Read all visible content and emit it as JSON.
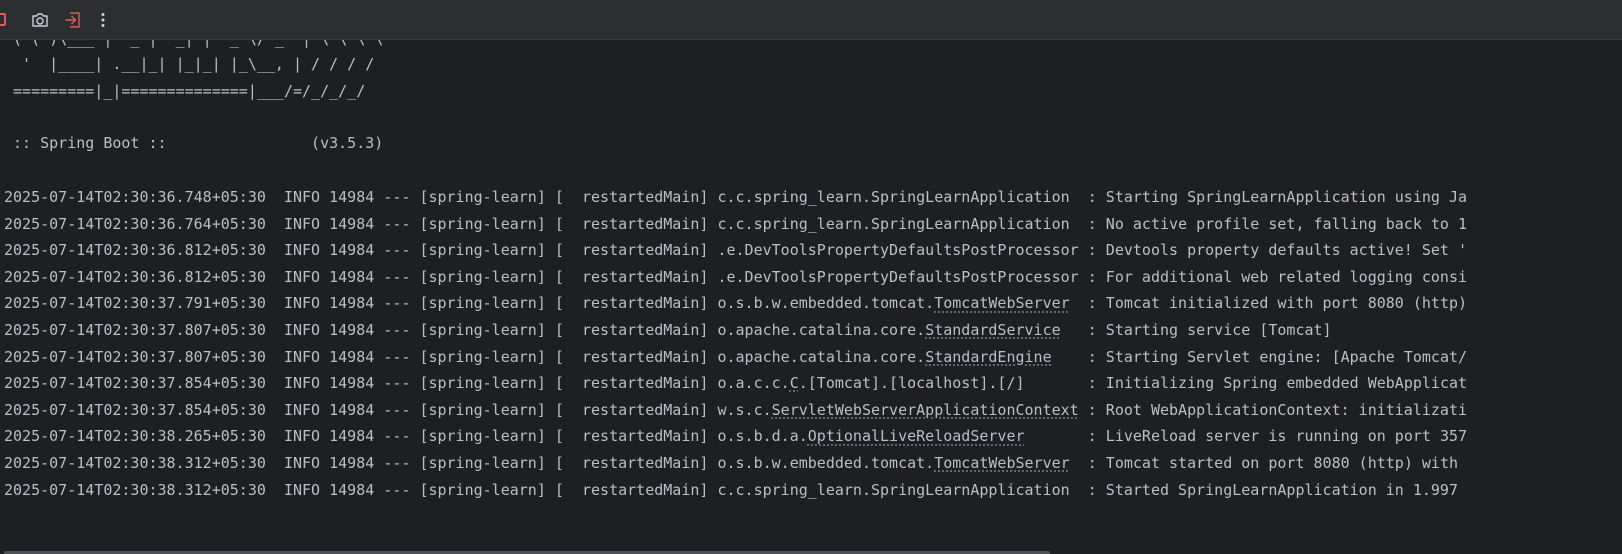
{
  "toolbar": {
    "icons": [
      "stop-icon",
      "camera-icon",
      "exit-icon",
      "more-vertical-icon"
    ],
    "accent_stop": "#db5c5c"
  },
  "banner": {
    "line_cut": " ( ( )\\___ | '_ | '_| | '_ \\/ _` | \\ \\ \\ \\",
    "line1": "  '  |____| .__|_| |_|_| |_\\__, | / / / /",
    "line2": " =========|_|==============|___/=/_/_/_/",
    "line3": "",
    "line4": " :: Spring Boot ::                (v3.5.3)"
  },
  "logs": [
    {
      "ts": "2025-07-14T02:30:36.748+05:30",
      "level": "INFO",
      "pid": "14984",
      "app": "[spring-learn]",
      "thread": "[  restartedMain]",
      "logger_prefix": "c.c.spring_learn.SpringLearnApplication",
      "logger_ul": "",
      "logger_suffix": "",
      "pad": "  ",
      "msg": ": Starting SpringLearnApplication using Ja"
    },
    {
      "ts": "2025-07-14T02:30:36.764+05:30",
      "level": "INFO",
      "pid": "14984",
      "app": "[spring-learn]",
      "thread": "[  restartedMain]",
      "logger_prefix": "c.c.spring_learn.SpringLearnApplication",
      "logger_ul": "",
      "logger_suffix": "",
      "pad": "  ",
      "msg": ": No active profile set, falling back to 1"
    },
    {
      "ts": "2025-07-14T02:30:36.812+05:30",
      "level": "INFO",
      "pid": "14984",
      "app": "[spring-learn]",
      "thread": "[  restartedMain]",
      "logger_prefix": ".e.DevToolsPropertyDefaultsPostProcessor",
      "logger_ul": "",
      "logger_suffix": "",
      "pad": " ",
      "msg": ": Devtools property defaults active! Set '"
    },
    {
      "ts": "2025-07-14T02:30:36.812+05:30",
      "level": "INFO",
      "pid": "14984",
      "app": "[spring-learn]",
      "thread": "[  restartedMain]",
      "logger_prefix": ".e.DevToolsPropertyDefaultsPostProcessor",
      "logger_ul": "",
      "logger_suffix": "",
      "pad": " ",
      "msg": ": For additional web related logging consi"
    },
    {
      "ts": "2025-07-14T02:30:37.791+05:30",
      "level": "INFO",
      "pid": "14984",
      "app": "[spring-learn]",
      "thread": "[  restartedMain]",
      "logger_prefix": "o.s.b.w.embedded.tomcat.",
      "logger_ul": "TomcatWebServer",
      "logger_suffix": "",
      "pad": "  ",
      "msg": ": Tomcat initialized with port 8080 (http)"
    },
    {
      "ts": "2025-07-14T02:30:37.807+05:30",
      "level": "INFO",
      "pid": "14984",
      "app": "[spring-learn]",
      "thread": "[  restartedMain]",
      "logger_prefix": "o.apache.catalina.core.",
      "logger_ul": "StandardService",
      "logger_suffix": "",
      "pad": "   ",
      "msg": ": Starting service [Tomcat]"
    },
    {
      "ts": "2025-07-14T02:30:37.807+05:30",
      "level": "INFO",
      "pid": "14984",
      "app": "[spring-learn]",
      "thread": "[  restartedMain]",
      "logger_prefix": "o.apache.catalina.core.",
      "logger_ul": "StandardEngine",
      "logger_suffix": "",
      "pad": "    ",
      "msg": ": Starting Servlet engine: [Apache Tomcat/"
    },
    {
      "ts": "2025-07-14T02:30:37.854+05:30",
      "level": "INFO",
      "pid": "14984",
      "app": "[spring-learn]",
      "thread": "[  restartedMain]",
      "logger_prefix": "o.a.c.c.",
      "logger_ul": "C",
      "logger_suffix": ".[Tomcat].[localhost].[/]",
      "pad": "       ",
      "msg": ": Initializing Spring embedded WebApplicat"
    },
    {
      "ts": "2025-07-14T02:30:37.854+05:30",
      "level": "INFO",
      "pid": "14984",
      "app": "[spring-learn]",
      "thread": "[  restartedMain]",
      "logger_prefix": "w.s.c.",
      "logger_ul": "ServletWebServerApplicationContext",
      "logger_suffix": "",
      "pad": " ",
      "msg": ": Root WebApplicationContext: initializati"
    },
    {
      "ts": "2025-07-14T02:30:38.265+05:30",
      "level": "INFO",
      "pid": "14984",
      "app": "[spring-learn]",
      "thread": "[  restartedMain]",
      "logger_prefix": "o.s.b.d.a.",
      "logger_ul": "OptionalLiveReloadServer",
      "logger_suffix": "",
      "pad": "       ",
      "msg": ": LiveReload server is running on port 357"
    },
    {
      "ts": "2025-07-14T02:30:38.312+05:30",
      "level": "INFO",
      "pid": "14984",
      "app": "[spring-learn]",
      "thread": "[  restartedMain]",
      "logger_prefix": "o.s.b.w.embedded.tomcat.",
      "logger_ul": "TomcatWebServer",
      "logger_suffix": "",
      "pad": "  ",
      "msg": ": Tomcat started on port 8080 (http) with"
    },
    {
      "ts": "2025-07-14T02:30:38.312+05:30",
      "level": "INFO",
      "pid": "14984",
      "app": "[spring-learn]",
      "thread": "[  restartedMain]",
      "logger_prefix": "c.c.spring_learn.SpringLearnApplication",
      "logger_ul": "",
      "logger_suffix": "",
      "pad": "  ",
      "msg": ": Started SpringLearnApplication in 1.997"
    }
  ]
}
